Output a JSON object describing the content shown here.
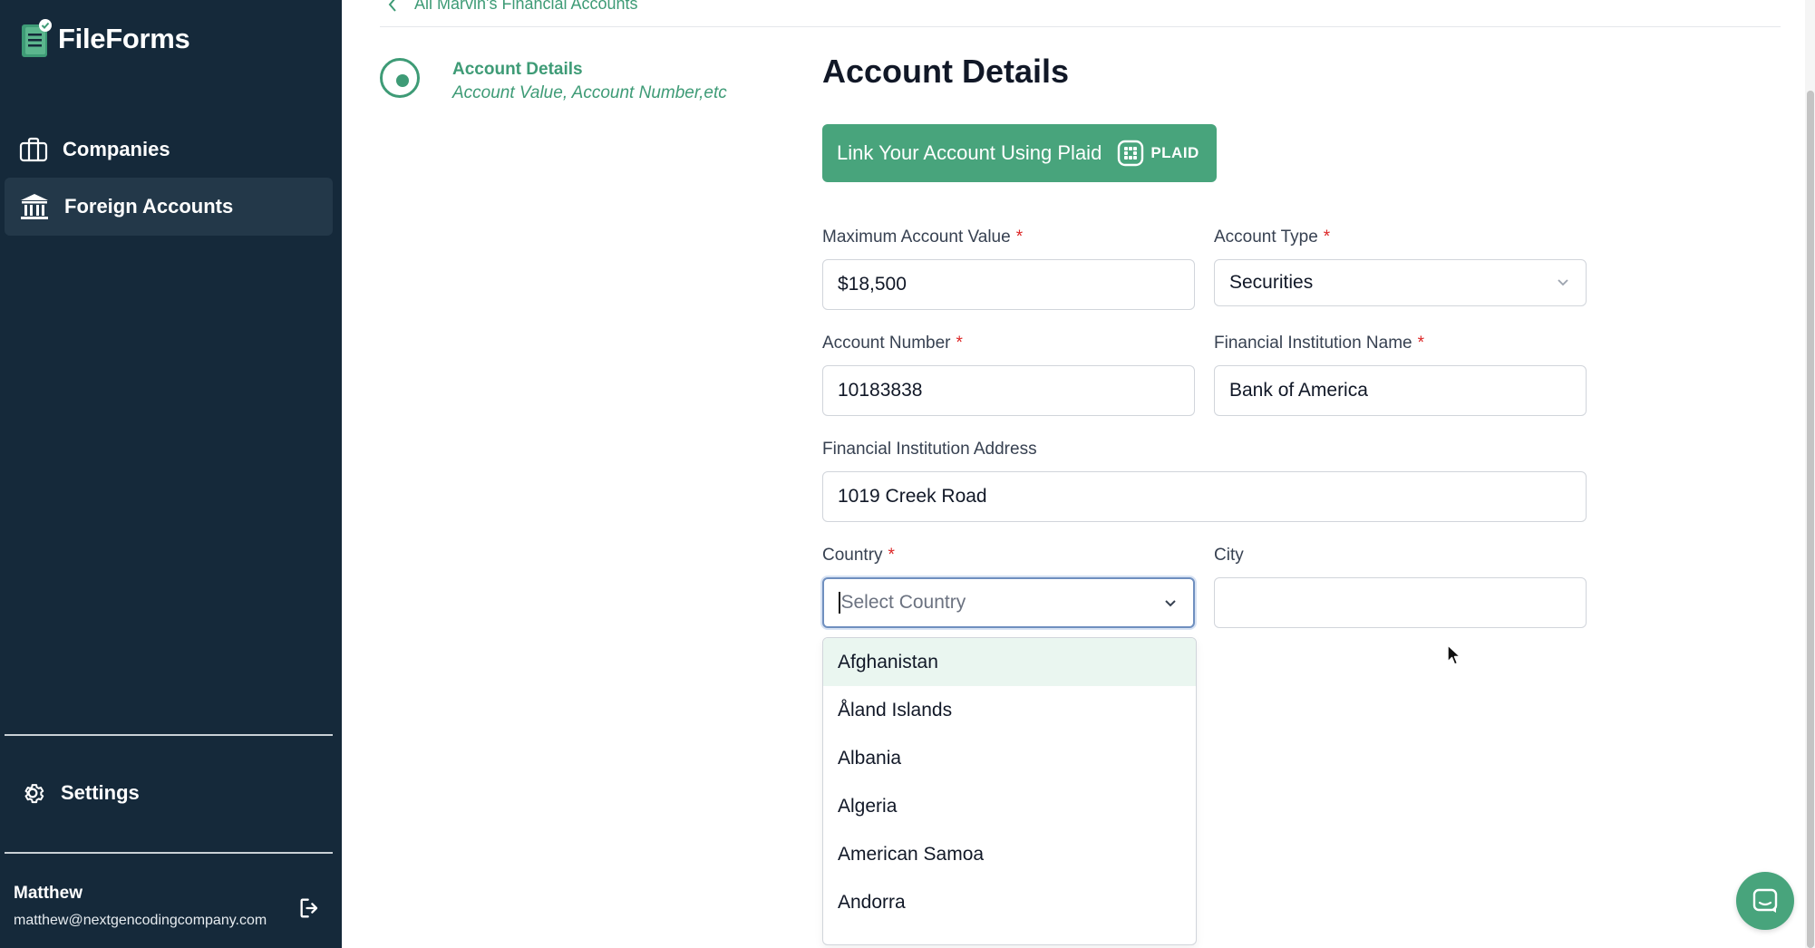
{
  "app": {
    "name": "FileForms"
  },
  "sidebar": {
    "items": [
      {
        "label": "Companies",
        "icon": "briefcase-icon",
        "active": false
      },
      {
        "label": "Foreign Accounts",
        "icon": "bank-icon",
        "active": true
      }
    ],
    "settings_label": "Settings",
    "user": {
      "name": "Matthew",
      "email": "matthew@nextgencodingcompany.com"
    }
  },
  "header": {
    "back_label": "All Marvin's Financial Accounts"
  },
  "stepper": {
    "title": "Account Details",
    "subtitle": "Account Value, Account Number,etc"
  },
  "form": {
    "title": "Account Details",
    "plaid_button": "Link Your Account Using Plaid",
    "plaid_brand": "PLAID",
    "max_value": {
      "label": "Maximum Account Value",
      "value": "$18,500"
    },
    "account_type": {
      "label": "Account Type",
      "value": "Securities"
    },
    "account_number": {
      "label": "Account Number",
      "value": "10183838"
    },
    "institution_name": {
      "label": "Financial Institution Name",
      "value": "Bank of America"
    },
    "institution_address": {
      "label": "Financial Institution Address",
      "value": "1019 Creek Road"
    },
    "country": {
      "label": "Country",
      "placeholder": "Select Country"
    },
    "city": {
      "label": "City",
      "value": ""
    },
    "required_mark": "*"
  },
  "country_options": [
    "Afghanistan",
    "Åland Islands",
    "Albania",
    "Algeria",
    "American Samoa",
    "Andorra"
  ],
  "colors": {
    "sidebar_bg": "#15293a",
    "accent": "#48a47c",
    "link": "#3e9b76",
    "required": "#dc2626"
  }
}
